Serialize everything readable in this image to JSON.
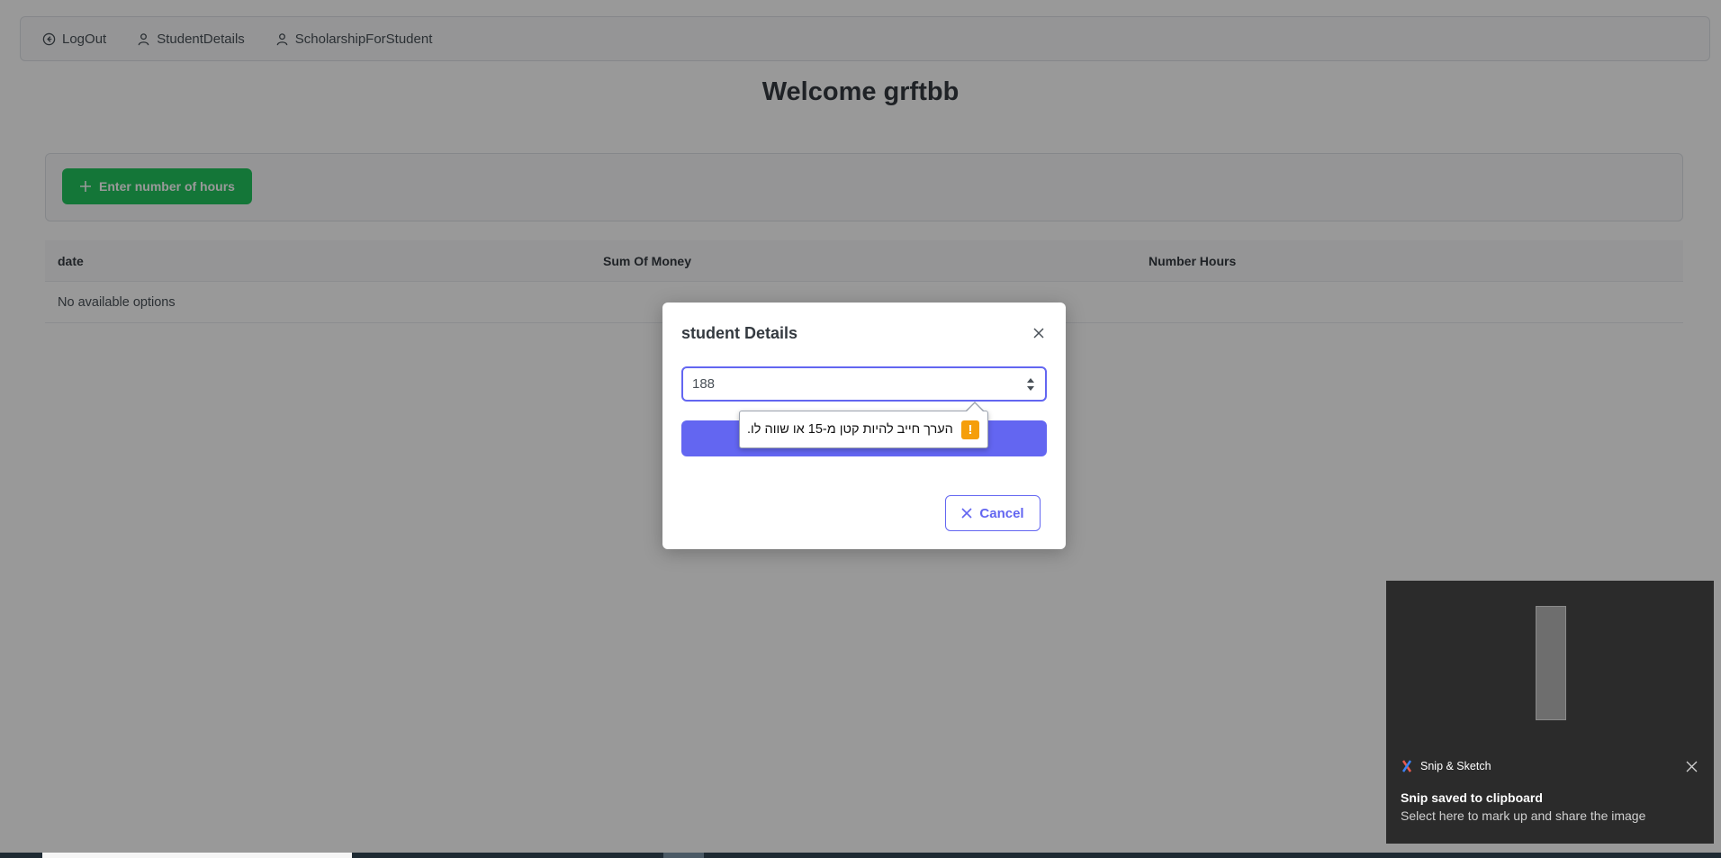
{
  "menubar": {
    "items": [
      {
        "label": "LogOut",
        "icon": "logout-icon"
      },
      {
        "label": "StudentDetails",
        "icon": "user-icon"
      },
      {
        "label": "ScholarshipForStudent",
        "icon": "user-icon"
      }
    ]
  },
  "page": {
    "welcome": "Welcome grftbb",
    "add_button_label": "Enter number of hours",
    "table": {
      "columns": [
        "date",
        "Sum Of Money",
        "Number Hours"
      ],
      "empty_message": "No available options"
    }
  },
  "dialog": {
    "title": "student Details",
    "hours_input_value": "188",
    "validation_message": "הערך חייב להיות קטן מ-15 או שווה לו.",
    "cancel_label": "Cancel"
  },
  "toast": {
    "app_name": "Snip & Sketch",
    "title": "Snip saved to clipboard",
    "subtitle": "Select here to mark up and share the image"
  },
  "colors": {
    "primary": "#6366f1",
    "success": "#22c55e",
    "warning": "#f59e0b"
  }
}
